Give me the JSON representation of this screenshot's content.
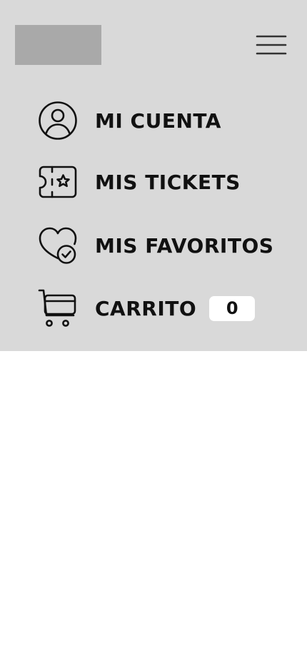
{
  "header": {
    "logo_color": "#a9a9a9",
    "menu_icon": "hamburger-menu-icon"
  },
  "menu": {
    "background": "#d9d9d9",
    "items": [
      {
        "label": "MI CUENTA",
        "icon": "user-circle-icon"
      },
      {
        "label": "MIS TICKETS",
        "icon": "ticket-star-icon"
      },
      {
        "label": "MIS FAVORITOS",
        "icon": "heart-check-icon"
      },
      {
        "label": "CARRITO",
        "icon": "shopping-cart-icon",
        "badge": "0"
      }
    ]
  }
}
